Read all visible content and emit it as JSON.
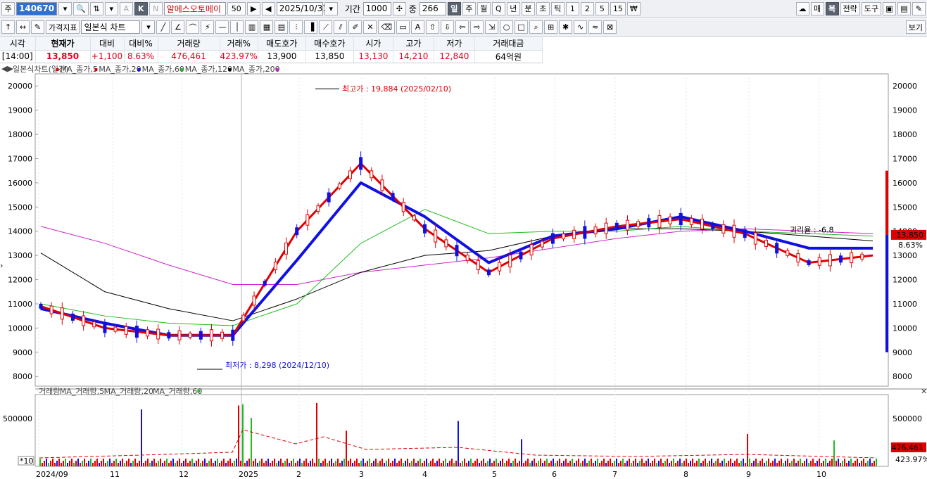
{
  "toolbar1": {
    "market_label": "주",
    "code": "140670",
    "stock_name": "알에스오토메이",
    "stock_suffix": "50",
    "date": "2025/10/31",
    "period_label": "기간",
    "period_value": "1000",
    "mid_label": "중",
    "mid_value": "266",
    "units": [
      "일",
      "주",
      "월",
      "Q",
      "년",
      "분",
      "초",
      "틱",
      "1",
      "2",
      "5",
      "15"
    ],
    "right_buttons": [
      "매",
      "복",
      "전략",
      "도구"
    ]
  },
  "toolbar2": {
    "price_indicator": "가격지표",
    "chart_type": "일본식 차트",
    "view_button": "보기"
  },
  "quote": {
    "headers": [
      "시각",
      "현재가",
      "대비",
      "대비%",
      "거래량",
      "거래%",
      "매도호가",
      "매수호가",
      "시가",
      "고가",
      "저가",
      "거래대금"
    ],
    "values": [
      "[14:00]",
      "13,850",
      "+1,100",
      "8.63%",
      "476,461",
      "423.97%",
      "13,900",
      "13,850",
      "13,130",
      "14,210",
      "12,840",
      "64억원"
    ]
  },
  "price_panel": {
    "legend": [
      {
        "text": "일본식차트(일간)",
        "color": "#555555"
      },
      {
        "text": "MA_종가,5",
        "color": "#e00000"
      },
      {
        "text": "MA_종가,20",
        "color": "#e00000"
      },
      {
        "text": "MA_종가,60",
        "color": "#1010e0"
      },
      {
        "text": "MA_종가,120",
        "color": "#22bb22"
      },
      {
        "text": "MA_종가,200",
        "color": "#000000"
      }
    ],
    "y_ticks": [
      20000,
      19000,
      18000,
      17000,
      16000,
      15000,
      14000,
      13000,
      12000,
      11000,
      10000,
      9000,
      8000
    ],
    "high_annotation": "최고가 : 19,884 (2025/02/10)",
    "low_annotation": "최저가 : 8,298 (2024/12/10)",
    "mid_annotation": "괴리율 : -6.8",
    "price_badge": "13,850",
    "pct_badge": "8.63%",
    "colors": {
      "up": "#e00000",
      "down": "#1010e0",
      "ma120": "#22bb22",
      "ma200": "#000000",
      "ma_long": "#cc22cc"
    }
  },
  "volume_panel": {
    "legend": [
      {
        "text": "거래량",
        "color": "#555555"
      },
      {
        "text": "MA_거래량,5",
        "color": "#e00000"
      },
      {
        "text": "MA_거래량,20",
        "color": "#000000"
      },
      {
        "text": "MA_거래량,60",
        "color": "#e00000"
      }
    ],
    "y_tick": "500000",
    "scale_label": "*10",
    "volume_badge": "476,461",
    "pct_badge": "423.97%"
  },
  "x_axis": [
    "2024/09",
    "11",
    "12",
    "2025",
    "2",
    "3",
    "4",
    "5",
    "6",
    "7",
    "8",
    "9",
    "10"
  ],
  "chart_data": {
    "type": "line",
    "title": "",
    "xlabel": "",
    "ylabel": "",
    "ylim": [
      7600,
      20500
    ],
    "x": [
      "2024/09",
      "2024/10",
      "2024/11",
      "2024/12",
      "2025/01",
      "2025/02",
      "2025/03",
      "2025/04",
      "2025/05",
      "2025/06",
      "2025/07",
      "2025/08",
      "2025/09",
      "2025/10"
    ],
    "series": [
      {
        "name": "MA_종가,5",
        "values": [
          10900,
          10000,
          9700,
          9700,
          14000,
          16800,
          14100,
          12300,
          13700,
          14200,
          14500,
          13900,
          12700,
          13000
        ]
      },
      {
        "name": "MA_종가,60",
        "values": [
          10800,
          10200,
          9700,
          9700,
          12800,
          16000,
          14600,
          12700,
          13800,
          14100,
          14600,
          14000,
          13300,
          13300
        ]
      },
      {
        "name": "MA_종가,120",
        "values": [
          11000,
          10500,
          10200,
          10100,
          11000,
          13500,
          14900,
          13900,
          14000,
          14000,
          14200,
          14000,
          13900,
          13800
        ]
      },
      {
        "name": "MA_종가,200",
        "values": [
          13100,
          11500,
          10800,
          10300,
          11200,
          12300,
          13000,
          13200,
          13800,
          14100,
          14100,
          14000,
          13800,
          13600
        ]
      }
    ],
    "extremes": {
      "high": 19884,
      "high_date": "2025/02/10",
      "low": 8298,
      "low_date": "2024/12/10"
    },
    "last_close": 13850
  }
}
